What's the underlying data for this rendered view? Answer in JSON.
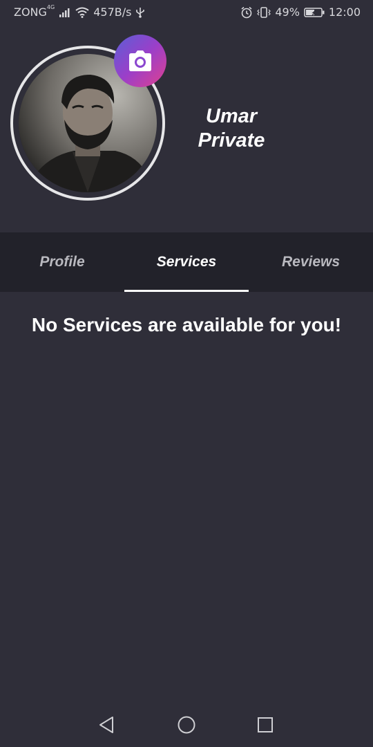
{
  "status_bar": {
    "carrier": "ZONG",
    "network_type": "4G",
    "net_speed": "457B/s",
    "battery": "49%",
    "time": "12:00",
    "icons": [
      "signal-icon",
      "wifi-icon",
      "usb-icon",
      "alarm-icon",
      "vibrate-icon",
      "battery-icon"
    ]
  },
  "profile": {
    "name_line1": "Umar",
    "name_line2": "Private",
    "camera_icon": "camera-icon"
  },
  "tabs": [
    {
      "label": "Profile",
      "active": false
    },
    {
      "label": "Services",
      "active": true
    },
    {
      "label": "Reviews",
      "active": false
    }
  ],
  "services": {
    "empty_message": "No Services are available for you!"
  },
  "navbar": {
    "icons": [
      "back-icon",
      "home-icon",
      "recents-icon"
    ]
  },
  "colors": {
    "background": "#2f2e39",
    "tab_bar": "#22222a",
    "active_text": "#ffffff",
    "inactive_text": "#b9b9bf",
    "camera_gradient": [
      "#5b5fd6",
      "#9a3fc9",
      "#e0418f"
    ]
  }
}
